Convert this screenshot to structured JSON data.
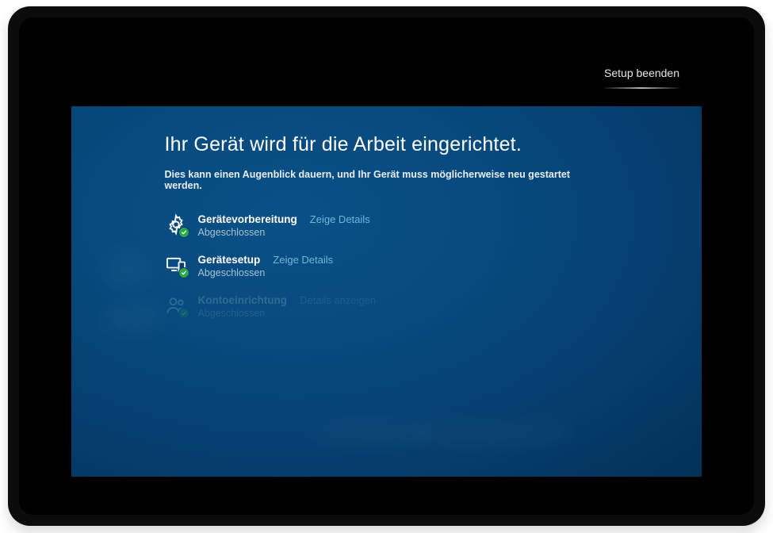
{
  "topbar": {
    "exit_label": "Setup beenden"
  },
  "oobe": {
    "title": "Ihr Gerät wird für die Arbeit eingerichtet.",
    "subtitle": "Dies kann einen Augenblick dauern, und Ihr Gerät muss möglicherweise neu gestartet werden.",
    "steps": [
      {
        "icon": "gear-icon",
        "name": "Gerätevorbereitung",
        "details_label": "Zeige Details",
        "status": "Abgeschlossen",
        "dimmed": false
      },
      {
        "icon": "devices-icon",
        "name": "Gerätesetup",
        "details_label": "Zeige Details",
        "status": "Abgeschlossen",
        "dimmed": false
      },
      {
        "icon": "user-icon",
        "name": "Kontoeinrichtung",
        "details_label": "Details anzeigen",
        "status": "Abgeschlossen",
        "dimmed": true
      }
    ]
  },
  "colors": {
    "accent_blue": "#0a5086",
    "success_green": "#2aa84a",
    "link": "#6fb7d9"
  }
}
